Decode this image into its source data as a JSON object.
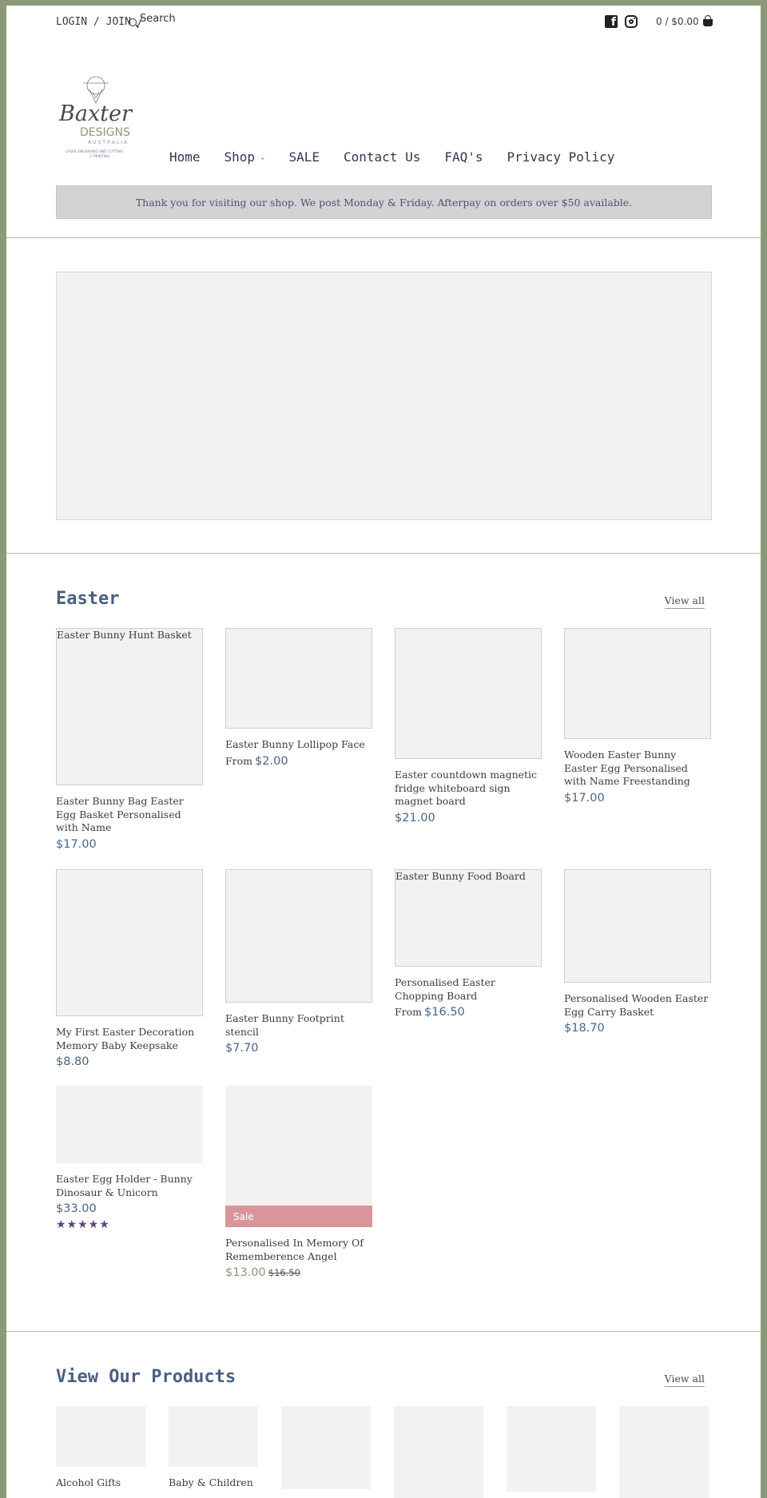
{
  "header": {
    "login": "LOGIN",
    "sep1": " / ",
    "join": "JOIN",
    "sep2": " / ",
    "search_placeholder": "Search",
    "cart_label": "0 / $0.00"
  },
  "logo": {
    "line1": "Baxter",
    "line2": "DESIGNS",
    "line3": "AUSTRALIA",
    "tagline1": "LASER ENGRAVING AND CUTTING",
    "tagline2": "+ PRINTING"
  },
  "nav": {
    "items": [
      {
        "label": "Home"
      },
      {
        "label": "Shop"
      },
      {
        "label": "SALE"
      },
      {
        "label": "Contact Us"
      },
      {
        "label": "FAQ's"
      },
      {
        "label": "Privacy Policy"
      }
    ]
  },
  "announcement": "Thank you for visiting our shop. We post Monday & Friday. Afterpay on orders over $50 available.",
  "easter": {
    "title": "Easter",
    "view_all": "View all",
    "products": [
      {
        "alt": "Easter Bunny Hunt Basket",
        "name": "Easter Bunny Bag Easter Egg Basket Personalised with Name",
        "from": "",
        "price": "$17.00"
      },
      {
        "alt": "",
        "name": "Easter Bunny Lollipop Face",
        "from": "From",
        "price": "$2.00"
      },
      {
        "alt": "",
        "name": "Easter countdown magnetic fridge whiteboard sign magnet board",
        "from": "",
        "price": "$21.00"
      },
      {
        "alt": "",
        "name": "Wooden Easter Bunny Easter Egg Personalised with Name Freestanding",
        "from": "",
        "price": "$17.00"
      },
      {
        "alt": "",
        "name": "My First Easter Decoration Memory Baby Keepsake",
        "from": "",
        "price": "$8.80"
      },
      {
        "alt": "",
        "name": "Easter Bunny Footprint stencil",
        "from": "",
        "price": "$7.70"
      },
      {
        "alt": "Easter Bunny Food Board",
        "name": "Personalised Easter Chopping Board",
        "from": "From",
        "price": "$16.50"
      },
      {
        "alt": "",
        "name": "Personalised Wooden Easter Egg Carry Basket",
        "from": "",
        "price": "$18.70"
      },
      {
        "alt": "",
        "name": "Easter Egg Holder - Bunny Dinosaur & Unicorn",
        "from": "",
        "price": "$33.00",
        "rating": 5,
        "stars": "★★★★★"
      },
      {
        "alt": "",
        "name": "Personalised In Memory Of Rememberence Angel",
        "from": "",
        "price": "$13.00",
        "old_price": "$16.50",
        "badge": "Sale"
      }
    ]
  },
  "collections": {
    "title": "View Our Products",
    "view_all": "View all",
    "items": [
      {
        "name": "Alcohol Gifts"
      },
      {
        "name": "Baby & Children"
      },
      {
        "name": ""
      },
      {
        "name": ""
      },
      {
        "name": ""
      },
      {
        "name": ""
      }
    ]
  },
  "colors": {
    "frame": "#8a9a78",
    "accent_title": "#4a5f80",
    "nav_text": "#3d3052",
    "sale_badge": "#d9959a",
    "announcement_bg": "#d3d3d3"
  }
}
